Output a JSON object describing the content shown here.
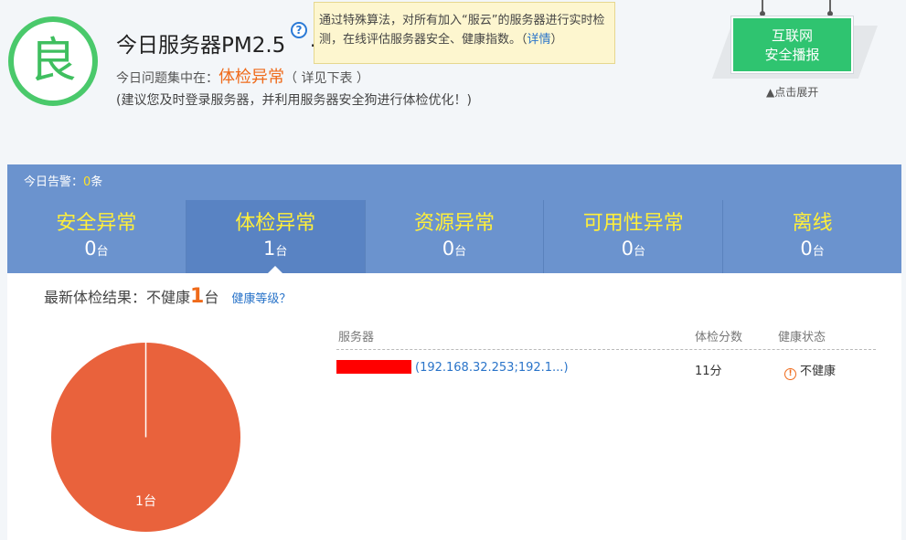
{
  "header": {
    "grade": "良",
    "title": "今日服务器PM2.5",
    "help_glyph": "?",
    "dot": ".",
    "tooltip_text": "通过特殊算法，对所有加入“服云”的服务器进行实时检测，在线评估服务器安全、健康指数。（",
    "tooltip_link": "详情",
    "tooltip_close": "）",
    "issue_prefix": "今日问题集中在：",
    "issue_focus": "体检异常",
    "issue_suffix": "（ 详见下表 ）",
    "advice": "(建议您及时登录服务器，并利用服务器安全狗进行体检优化！)"
  },
  "broadcast": {
    "line1": "互联网",
    "line2": "安全播报",
    "hint": "点击展开"
  },
  "alerts": {
    "label": "今日告警：",
    "count": "0",
    "unit": "条"
  },
  "tabs": [
    {
      "label": "安全异常",
      "count": "0",
      "unit": "台"
    },
    {
      "label": "体检异常",
      "count": "1",
      "unit": "台"
    },
    {
      "label": "资源异常",
      "count": "0",
      "unit": "台"
    },
    {
      "label": "可用性异常",
      "count": "0",
      "unit": "台"
    },
    {
      "label": "离线",
      "count": "0",
      "unit": "台"
    }
  ],
  "result": {
    "prefix": "最新体检结果：不健康",
    "count": "1",
    "unit": "台",
    "health_link": "健康等级？"
  },
  "table": {
    "headers": [
      "服务器",
      "体检分数",
      "健康状态"
    ],
    "rows": [
      {
        "server_ip": "(192.168.32.253;192.1...)",
        "score": "11分",
        "status": "不健康",
        "status_icon": "warning-icon"
      }
    ]
  },
  "pie": {
    "label": "1台",
    "fill": "#e9623c"
  },
  "colors": {
    "grade_green": "#4ac96b",
    "highlight_orange": "#ef6a1a",
    "tab_bar": "#6b93ce",
    "tab_label_yellow": "#ffef3a",
    "link_blue": "#2a74c9",
    "broadcast_green": "#2fc470"
  }
}
